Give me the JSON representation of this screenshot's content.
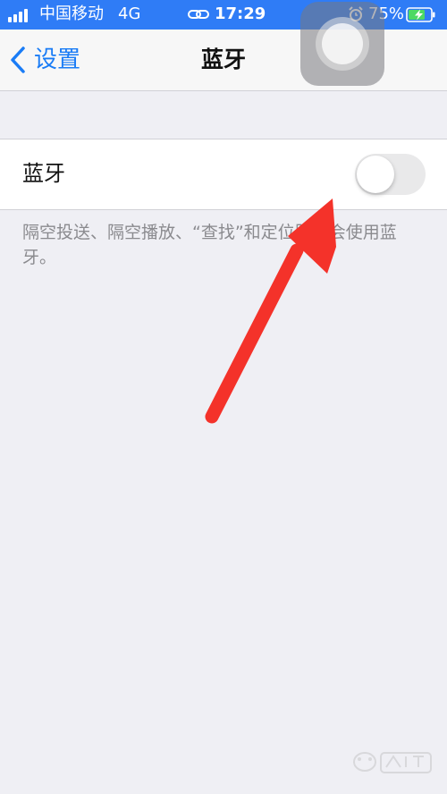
{
  "status_bar": {
    "carrier": "中国移动",
    "network": "4G",
    "time": "17:29",
    "battery_percent": "75%",
    "icons": [
      "signal-icon",
      "link-icon",
      "alarm-icon",
      "battery-charging-icon"
    ]
  },
  "nav": {
    "back_label": "设置",
    "title": "蓝牙"
  },
  "setting": {
    "label": "蓝牙",
    "toggle_on": false
  },
  "footer_text": "隔空投送、隔空播放、“查找”和定位服务会使用蓝牙。",
  "colors": {
    "status_bar": "#2f7cf6",
    "accent": "#1a7cf6",
    "annotation_arrow": "#f4322a",
    "background": "#efeff4"
  }
}
